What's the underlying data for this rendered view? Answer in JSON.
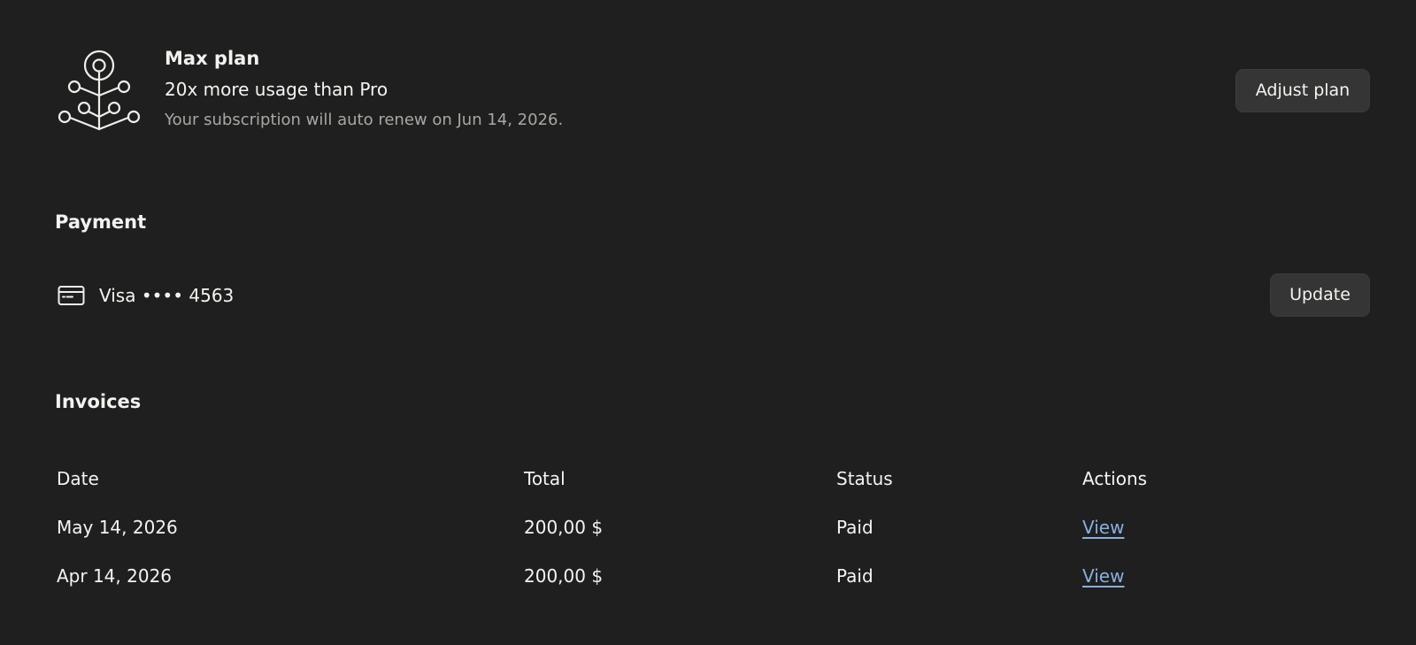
{
  "plan": {
    "icon": "plan-tree-icon",
    "name": "Max plan",
    "description": "20x more usage than Pro",
    "renewal": "Your subscription will auto renew on Jun 14, 2026.",
    "adjust_label": "Adjust plan"
  },
  "payment": {
    "heading": "Payment",
    "card_icon": "credit-card-icon",
    "card_label": "Visa •••• 4563",
    "update_label": "Update"
  },
  "invoices": {
    "heading": "Invoices",
    "columns": [
      "Date",
      "Total",
      "Status",
      "Actions"
    ],
    "rows": [
      {
        "date": "May 14, 2026",
        "total": "200,00 $",
        "status": "Paid",
        "action": "View"
      },
      {
        "date": "Apr 14, 2026",
        "total": "200,00 $",
        "status": "Paid",
        "action": "View"
      }
    ]
  },
  "colors": {
    "background": "#1f1f1f",
    "button_bg": "#353535",
    "link": "#8aaee0",
    "muted_text": "#a8a8a3"
  }
}
